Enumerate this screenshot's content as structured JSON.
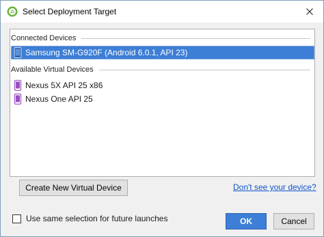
{
  "window": {
    "title": "Select Deployment Target",
    "app_icon": "android-studio-icon",
    "close_icon": "close-icon"
  },
  "device_list": {
    "connected": {
      "header": "Connected Devices",
      "devices": [
        {
          "name": "Samsung SM-G920F (Android 6.0.1, API 23)",
          "icon": "phone-icon",
          "selected": true
        }
      ]
    },
    "virtual": {
      "header": "Available Virtual Devices",
      "devices": [
        {
          "name": "Nexus 5X API 25 x86",
          "icon": "emulator-phone-icon",
          "selected": false
        },
        {
          "name": "Nexus One API 25",
          "icon": "emulator-phone-icon",
          "selected": false
        }
      ]
    }
  },
  "actions": {
    "create_virtual_device": "Create New Virtual Device",
    "help_link": "Don't see your device?",
    "remember_checkbox": {
      "label": "Use same selection for future launches",
      "checked": false
    },
    "ok": "OK",
    "cancel": "Cancel"
  },
  "colors": {
    "selection": "#3d7ed6",
    "link": "#1155cc",
    "device_icon": "#9a4fc0"
  }
}
